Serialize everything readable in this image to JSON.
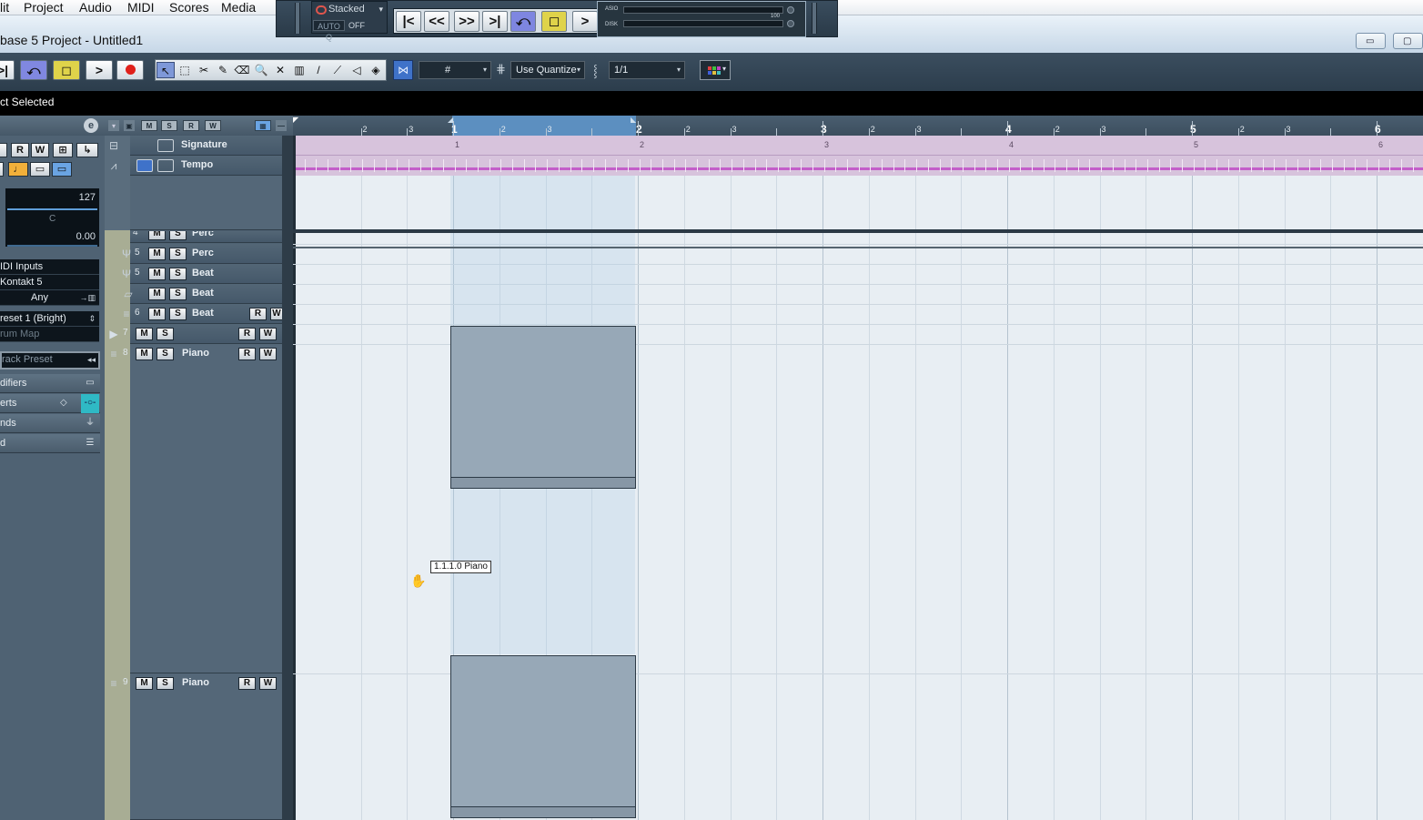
{
  "menu": [
    "lit",
    "Project",
    "Audio",
    "MIDI",
    "Scores",
    "Media"
  ],
  "mini_transport": {
    "stacked": "Stacked",
    "autoq": "AUTO Q",
    "autoq_value": "OFF",
    "meter_asio": "ASIO",
    "meter_disk": "DISK",
    "meter_max": "100"
  },
  "window": {
    "title": "base 5 Project - Untitled1",
    "minimize": "▭",
    "maximize": "▢"
  },
  "toolbar": {
    "quantize_label": "Use Quantize",
    "quantize_value": "1/1",
    "grid_icon": "#"
  },
  "info_line": "ct Selected",
  "inspector": {
    "e_button": "e",
    "r": "R",
    "w": "W",
    "volume_value": "127",
    "pan_value": "C",
    "delay_value": "0.00",
    "midi_input": "IDI Inputs",
    "output": "Kontakt 5",
    "channel": "Any",
    "program": "reset 1 (Bright)",
    "drum_map": "rum Map",
    "track_preset": "rack Preset",
    "sections": [
      "difiers",
      "erts",
      "nds",
      "d"
    ]
  },
  "tracklist_header": [
    "M",
    "S",
    "R",
    "W"
  ],
  "global_tracks": [
    {
      "name": "Signature"
    },
    {
      "name": "Tempo"
    }
  ],
  "tracks": [
    {
      "num": "4",
      "name": "Perc",
      "m": "M",
      "s": "S"
    },
    {
      "num": "5",
      "name": "Perc",
      "m": "M",
      "s": "S"
    },
    {
      "num": "5",
      "name": "Beat",
      "m": "M",
      "s": "S"
    },
    {
      "num": "",
      "name": "Beat",
      "m": "M",
      "s": "S"
    },
    {
      "num": "6",
      "name": "Beat",
      "m": "M",
      "s": "S",
      "r": "R",
      "w": "W"
    },
    {
      "num": "7",
      "name": "",
      "m": "M",
      "s": "S",
      "r": "R",
      "w": "W"
    },
    {
      "num": "8",
      "name": "Piano",
      "m": "M",
      "s": "S",
      "r": "R",
      "w": "W"
    },
    {
      "num": "9",
      "name": "Piano",
      "m": "M",
      "s": "S",
      "r": "R",
      "w": "W"
    }
  ],
  "ruler": {
    "bars": [
      "1",
      "2",
      "3",
      "4",
      "5",
      "6"
    ],
    "beats": [
      "2",
      "3"
    ]
  },
  "signature_lane": [
    "1",
    "2",
    "3",
    "4",
    "5",
    "6"
  ],
  "tooltip": "1.1.1.0   Piano",
  "colors": {
    "loop_highlight": "#5c8fc0",
    "tempo_line": "#c35ec9",
    "part_fill": "#97a8b7",
    "record": "#e0201a",
    "stop": "#dfd34a",
    "cycle": "#8088e0"
  }
}
